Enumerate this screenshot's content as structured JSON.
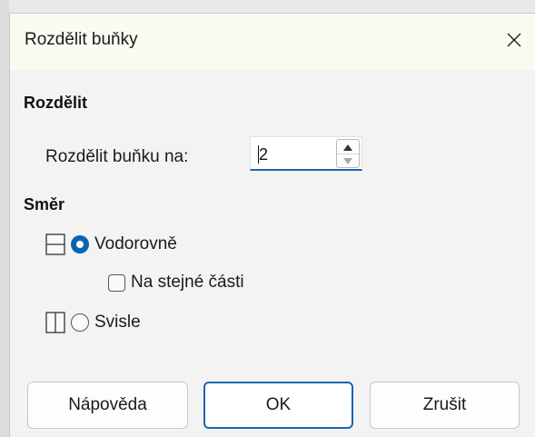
{
  "window": {
    "title": "Rozdělit buňky"
  },
  "split_section": {
    "heading": "Rozdělit",
    "field_label": "Rozdělit buňku na:",
    "field_value": "2"
  },
  "direction_section": {
    "heading": "Směr",
    "horizontal": {
      "label": "Vodorovně",
      "checked": true
    },
    "equal_parts": {
      "label": "Na stejné části",
      "checked": false
    },
    "vertical": {
      "label": "Svisle",
      "checked": false
    }
  },
  "buttons": {
    "help": "Nápověda",
    "ok": "OK",
    "cancel": "Zrušit"
  },
  "colors": {
    "accent": "#1a64b4",
    "title_bg": "#fbfaf1",
    "dialog_bg": "#f3f3f3"
  },
  "icons": {
    "close": "close-icon",
    "spin_up": "arrow-up-icon",
    "spin_down": "arrow-down-icon",
    "horizontal_split": "split-horizontal-icon",
    "vertical_split": "split-vertical-icon"
  }
}
